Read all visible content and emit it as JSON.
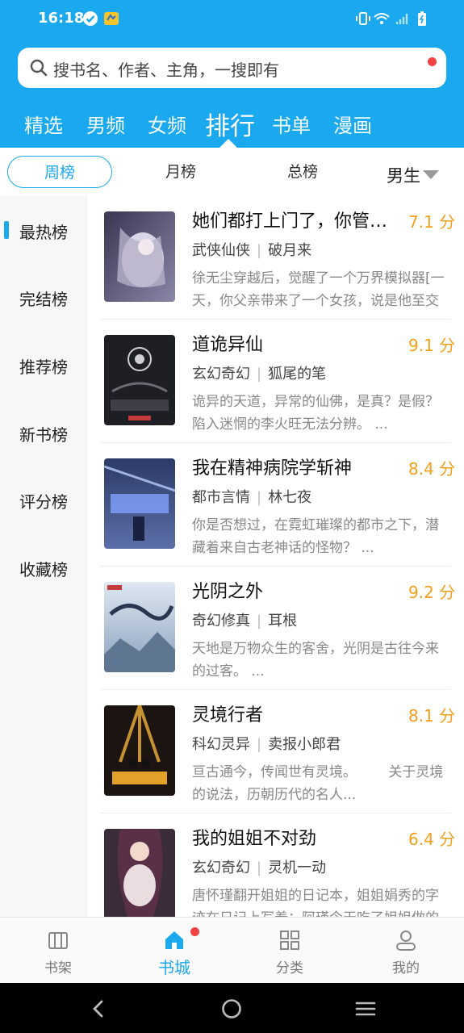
{
  "status": {
    "time": "16:18"
  },
  "search": {
    "placeholder": "搜书名、作者、主角，一搜即有"
  },
  "tabs": [
    {
      "label": "精选",
      "active": false
    },
    {
      "label": "男频",
      "active": false
    },
    {
      "label": "女频",
      "active": false
    },
    {
      "label": "排行",
      "active": true
    },
    {
      "label": "书单",
      "active": false
    },
    {
      "label": "漫画",
      "active": false
    }
  ],
  "period": {
    "weekly": "周榜",
    "monthly": "月榜",
    "total": "总榜",
    "gender": "男生"
  },
  "sidebar": [
    {
      "label": "最热榜",
      "active": true
    },
    {
      "label": "完结榜",
      "active": false
    },
    {
      "label": "推荐榜",
      "active": false
    },
    {
      "label": "新书榜",
      "active": false
    },
    {
      "label": "评分榜",
      "active": false
    },
    {
      "label": "收藏榜",
      "active": false
    }
  ],
  "books": [
    {
      "title": "她们都打上门了，你管这叫模拟器？",
      "score": "7.1 分",
      "genre": "武侠仙侠",
      "author": "破月来",
      "desc": "徐无尘穿越后，觉醒了一个万界模拟器[一天，你父亲带来了一个女孩，说是他至交好友的女儿……"
    },
    {
      "title": "道诡异仙",
      "score": "9.1 分",
      "genre": "玄幻奇幻",
      "author": "狐尾的笔",
      "desc": "诡异的天道，异常的仙佛，是真？是假？陷入迷惘的李火旺无法分辨。 ..."
    },
    {
      "title": "我在精神病院学斩神",
      "score": "8.4 分",
      "genre": "都市言情",
      "author": "林七夜",
      "desc": "你是否想过，在霓虹璀璨的都市之下，潜藏着来自古老神话的怪物？ ..."
    },
    {
      "title": "光阴之外",
      "score": "9.2 分",
      "genre": "奇幻修真",
      "author": "耳根",
      "desc": "天地是万物众生的客舍，光阴是古往今来的过客。 ..."
    },
    {
      "title": "灵境行者",
      "score": "8.1 分",
      "genre": "科幻灵异",
      "author": "卖报小郎君",
      "desc": "亘古通今，传闻世有灵境。 　　关于灵境的说法，历朝历代的名人..."
    },
    {
      "title": "我的姐姐不对劲",
      "score": "6.4 分",
      "genre": "玄幻奇幻",
      "author": "灵机一动",
      "desc": "唐怀瑾翻开姐姐的日记本，姐姐娟秀的字迹在日记上写着：阿瑾今天吃了姐姐做的饭"
    }
  ],
  "nav": [
    {
      "label": "书架",
      "icon": "bookshelf-icon"
    },
    {
      "label": "书城",
      "icon": "home-icon"
    },
    {
      "label": "分类",
      "icon": "category-icon"
    },
    {
      "label": "我的",
      "icon": "profile-icon"
    }
  ],
  "colors": {
    "accent": "#1aa8ee",
    "score": "#f2a01c",
    "dot": "#f04444"
  }
}
